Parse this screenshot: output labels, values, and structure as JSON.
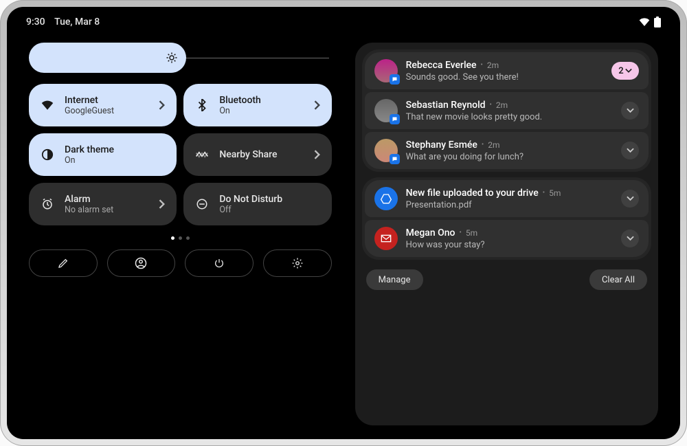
{
  "status": {
    "time": "9:30",
    "date": "Tue, Mar 8"
  },
  "quicksettings": {
    "tiles": [
      {
        "id": "internet",
        "title": "Internet",
        "sub": "GoogleGuest",
        "on": true,
        "chevron": true
      },
      {
        "id": "bluetooth",
        "title": "Bluetooth",
        "sub": "On",
        "on": true,
        "chevron": true
      },
      {
        "id": "darktheme",
        "title": "Dark theme",
        "sub": "On",
        "on": true,
        "chevron": false
      },
      {
        "id": "nearby",
        "title": "Nearby Share",
        "sub": "",
        "on": false,
        "chevron": true
      },
      {
        "id": "alarm",
        "title": "Alarm",
        "sub": "No alarm set",
        "on": false,
        "chevron": true
      },
      {
        "id": "dnd",
        "title": "Do Not Disturb",
        "sub": "Off",
        "on": false,
        "chevron": false
      }
    ]
  },
  "notifications": {
    "group_badge": "2",
    "items": [
      {
        "sender": "Rebecca Everlee",
        "time": "2m",
        "message": "Sounds good. See you there!"
      },
      {
        "sender": "Sebastian Reynold",
        "time": "2m",
        "message": "That new movie looks pretty good."
      },
      {
        "sender": "Stephany Esmée",
        "time": "2m",
        "message": "What are you doing for lunch?"
      },
      {
        "sender": "New file uploaded to your drive",
        "time": "5m",
        "message": "Presentation.pdf"
      },
      {
        "sender": "Megan Ono",
        "time": "5m",
        "message": "How was your stay?"
      }
    ],
    "manage_label": "Manage",
    "clear_label": "Clear All"
  }
}
